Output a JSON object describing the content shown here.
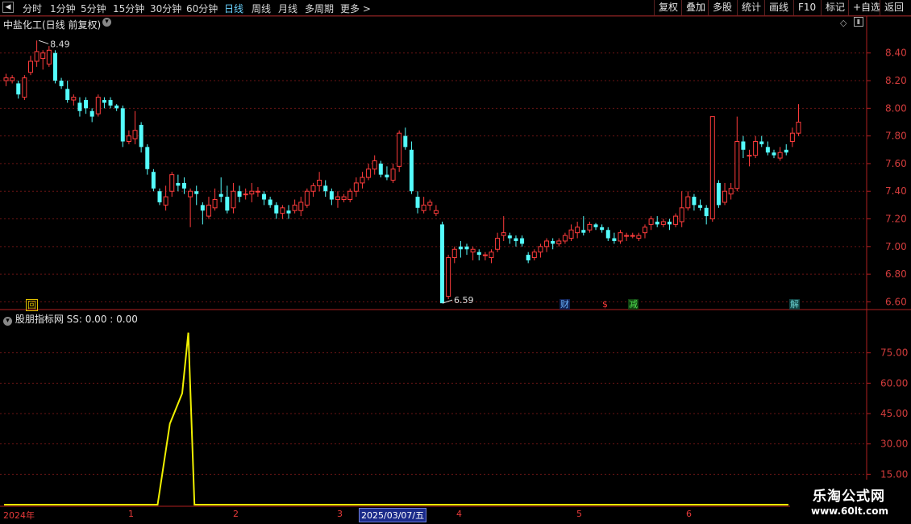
{
  "toolbar": {
    "periods": [
      "分时",
      "1分钟",
      "5分钟",
      "15分钟",
      "30分钟",
      "60分钟",
      "日线",
      "周线",
      "月线",
      "多周期",
      "更多 >"
    ],
    "buttons": [
      "复权",
      "叠加",
      "多股",
      "统计",
      "画线",
      "F10",
      "标记",
      "+自选",
      "返回"
    ]
  },
  "chart": {
    "title": "中盐化工(日线 前复权)",
    "price_axis": [
      "8.40",
      "8.20",
      "8.00",
      "7.80",
      "7.60",
      "7.40",
      "7.20",
      "7.00",
      "6.80",
      "6.60"
    ],
    "high_label": "8.49",
    "low_label": "6.59",
    "markers": [
      {
        "text": "回",
        "color": "#e0c000"
      },
      {
        "text": "财",
        "color": "#6ab4ff"
      },
      {
        "text": "$",
        "color": "#ff3a3a"
      },
      {
        "text": "减",
        "color": "#50e050"
      },
      {
        "text": "解",
        "color": "#6ad2d2"
      }
    ]
  },
  "indicator": {
    "title": "股朋指标网  SS: 0.00 : 0.00",
    "axis": [
      "75.00",
      "60.00",
      "45.00",
      "30.00",
      "15.00"
    ]
  },
  "timeline": {
    "labels": [
      "2024年",
      "1",
      "2",
      "3",
      "4",
      "5",
      "6"
    ],
    "selected_date": "2025/03/07/五"
  },
  "watermark": {
    "line1": "乐淘公式网",
    "line2": "www.60lt.com"
  },
  "chart_data": {
    "type": "candlestick",
    "ylim": [
      6.55,
      8.55
    ],
    "candles": [
      [
        8.2,
        8.22,
        8.25,
        8.16
      ],
      [
        8.2,
        8.22,
        8.24,
        8.18
      ],
      [
        8.18,
        8.1,
        8.2,
        8.07
      ],
      [
        8.08,
        8.22,
        8.24,
        8.06
      ],
      [
        8.26,
        8.34,
        8.38,
        8.24
      ],
      [
        8.34,
        8.41,
        8.49,
        8.3
      ],
      [
        8.36,
        8.4,
        8.42,
        8.28
      ],
      [
        8.32,
        8.42,
        8.45,
        8.3
      ],
      [
        8.4,
        8.2,
        8.42,
        8.18
      ],
      [
        8.2,
        8.16,
        8.22,
        8.14
      ],
      [
        8.14,
        8.06,
        8.2,
        8.04
      ],
      [
        8.06,
        8.08,
        8.1,
        8.02
      ],
      [
        8.04,
        7.98,
        8.08,
        7.94
      ],
      [
        8.06,
        8.0,
        8.08,
        7.96
      ],
      [
        7.98,
        7.94,
        8.0,
        7.9
      ],
      [
        7.96,
        8.08,
        8.1,
        7.94
      ],
      [
        8.06,
        8.04,
        8.08,
        8.0
      ],
      [
        8.06,
        8.02,
        8.08,
        8.0
      ],
      [
        8.02,
        8.0,
        8.03,
        7.98
      ],
      [
        8.0,
        7.76,
        8.02,
        7.72
      ],
      [
        7.76,
        7.8,
        7.84,
        7.74
      ],
      [
        7.78,
        7.84,
        7.98,
        7.74
      ],
      [
        7.88,
        7.72,
        7.9,
        7.68
      ],
      [
        7.72,
        7.56,
        7.74,
        7.52
      ],
      [
        7.54,
        7.42,
        7.56,
        7.4
      ],
      [
        7.4,
        7.32,
        7.42,
        7.3
      ],
      [
        7.3,
        7.36,
        7.44,
        7.26
      ],
      [
        7.4,
        7.52,
        7.54,
        7.36
      ],
      [
        7.46,
        7.44,
        7.52,
        7.4
      ],
      [
        7.46,
        7.42,
        7.5,
        7.38
      ],
      [
        7.36,
        7.4,
        7.42,
        7.14
      ],
      [
        7.4,
        7.38,
        7.44,
        7.3
      ],
      [
        7.3,
        7.26,
        7.32,
        7.16
      ],
      [
        7.22,
        7.3,
        7.36,
        7.2
      ],
      [
        7.28,
        7.34,
        7.42,
        7.26
      ],
      [
        7.38,
        7.36,
        7.5,
        7.32
      ],
      [
        7.36,
        7.26,
        7.44,
        7.24
      ],
      [
        7.28,
        7.4,
        7.46,
        7.24
      ],
      [
        7.4,
        7.36,
        7.44,
        7.32
      ],
      [
        7.38,
        7.38,
        7.42,
        7.34
      ],
      [
        7.38,
        7.4,
        7.46,
        7.32
      ],
      [
        7.4,
        7.4,
        7.43,
        7.36
      ],
      [
        7.38,
        7.34,
        7.4,
        7.3
      ],
      [
        7.34,
        7.3,
        7.36,
        7.28
      ],
      [
        7.3,
        7.24,
        7.32,
        7.2
      ],
      [
        7.24,
        7.28,
        7.3,
        7.2
      ],
      [
        7.26,
        7.24,
        7.3,
        7.2
      ],
      [
        7.26,
        7.3,
        7.34,
        7.24
      ],
      [
        7.26,
        7.32,
        7.36,
        7.22
      ],
      [
        7.3,
        7.4,
        7.42,
        7.28
      ],
      [
        7.4,
        7.44,
        7.46,
        7.36
      ],
      [
        7.44,
        7.48,
        7.54,
        7.4
      ],
      [
        7.44,
        7.4,
        7.48,
        7.36
      ],
      [
        7.4,
        7.34,
        7.42,
        7.3
      ],
      [
        7.34,
        7.36,
        7.4,
        7.28
      ],
      [
        7.34,
        7.36,
        7.38,
        7.32
      ],
      [
        7.34,
        7.4,
        7.42,
        7.32
      ],
      [
        7.4,
        7.46,
        7.5,
        7.36
      ],
      [
        7.46,
        7.5,
        7.54,
        7.42
      ],
      [
        7.5,
        7.56,
        7.6,
        7.48
      ],
      [
        7.56,
        7.62,
        7.66,
        7.52
      ],
      [
        7.6,
        7.52,
        7.62,
        7.5
      ],
      [
        7.52,
        7.5,
        7.58,
        7.48
      ],
      [
        7.48,
        7.56,
        7.6,
        7.46
      ],
      [
        7.58,
        7.82,
        7.84,
        7.54
      ],
      [
        7.8,
        7.72,
        7.86,
        7.7
      ],
      [
        7.7,
        7.4,
        7.76,
        7.38
      ],
      [
        7.36,
        7.28,
        7.4,
        7.24
      ],
      [
        7.26,
        7.3,
        7.36,
        7.24
      ],
      [
        7.3,
        7.32,
        7.34,
        7.26
      ],
      [
        7.24,
        7.26,
        7.3,
        7.22
      ],
      [
        7.16,
        6.59,
        7.18,
        6.59
      ],
      [
        6.64,
        6.92,
        6.94,
        6.62
      ],
      [
        6.92,
        6.98,
        7.0,
        6.88
      ],
      [
        7.0,
        6.98,
        7.04,
        6.92
      ],
      [
        7.0,
        6.98,
        7.02,
        6.94
      ],
      [
        6.96,
        6.98,
        7.0,
        6.9
      ],
      [
        6.96,
        6.94,
        6.98,
        6.9
      ],
      [
        6.94,
        6.94,
        6.96,
        6.9
      ],
      [
        6.92,
        6.96,
        6.98,
        6.88
      ],
      [
        6.98,
        7.06,
        7.1,
        6.96
      ],
      [
        7.08,
        7.1,
        7.22,
        7.04
      ],
      [
        7.08,
        7.06,
        7.1,
        7.02
      ],
      [
        7.06,
        7.04,
        7.08,
        7.0
      ],
      [
        7.06,
        7.02,
        7.08,
        7.0
      ],
      [
        6.94,
        6.9,
        6.96,
        6.88
      ],
      [
        6.92,
        6.96,
        6.98,
        6.9
      ],
      [
        6.96,
        7.0,
        7.02,
        6.92
      ],
      [
        7.0,
        7.04,
        7.06,
        6.96
      ],
      [
        7.04,
        7.02,
        7.06,
        6.98
      ],
      [
        7.02,
        7.04,
        7.06,
        7.0
      ],
      [
        7.04,
        7.08,
        7.1,
        7.02
      ],
      [
        7.06,
        7.12,
        7.16,
        7.04
      ],
      [
        7.1,
        7.14,
        7.18,
        7.06
      ],
      [
        7.12,
        7.1,
        7.22,
        7.08
      ],
      [
        7.12,
        7.16,
        7.18,
        7.1
      ],
      [
        7.16,
        7.14,
        7.17,
        7.12
      ],
      [
        7.14,
        7.12,
        7.16,
        7.1
      ],
      [
        7.12,
        7.06,
        7.14,
        7.04
      ],
      [
        7.06,
        7.04,
        7.1,
        7.02
      ],
      [
        7.04,
        7.1,
        7.12,
        7.02
      ],
      [
        7.08,
        7.08,
        7.1,
        7.04
      ],
      [
        7.08,
        7.08,
        7.1,
        7.06
      ],
      [
        7.06,
        7.08,
        7.1,
        7.04
      ],
      [
        7.1,
        7.14,
        7.16,
        7.06
      ],
      [
        7.16,
        7.2,
        7.22,
        7.12
      ],
      [
        7.18,
        7.16,
        7.22,
        7.14
      ],
      [
        7.16,
        7.18,
        7.2,
        7.14
      ],
      [
        7.18,
        7.16,
        7.2,
        7.12
      ],
      [
        7.16,
        7.22,
        7.24,
        7.14
      ],
      [
        7.18,
        7.28,
        7.4,
        7.14
      ],
      [
        7.28,
        7.36,
        7.4,
        7.26
      ],
      [
        7.36,
        7.3,
        7.38,
        7.26
      ],
      [
        7.3,
        7.28,
        7.34,
        7.26
      ],
      [
        7.28,
        7.22,
        7.3,
        7.16
      ],
      [
        7.2,
        7.94,
        7.94,
        7.18
      ],
      [
        7.46,
        7.3,
        7.48,
        7.28
      ],
      [
        7.32,
        7.4,
        7.46,
        7.3
      ],
      [
        7.38,
        7.42,
        7.46,
        7.34
      ],
      [
        7.42,
        7.76,
        7.94,
        7.4
      ],
      [
        7.76,
        7.7,
        7.8,
        7.64
      ],
      [
        7.66,
        7.66,
        7.7,
        7.58
      ],
      [
        7.66,
        7.76,
        7.8,
        7.64
      ],
      [
        7.76,
        7.74,
        7.8,
        7.72
      ],
      [
        7.72,
        7.68,
        7.76,
        7.66
      ],
      [
        7.68,
        7.66,
        7.7,
        7.64
      ],
      [
        7.64,
        7.68,
        7.72,
        7.62
      ],
      [
        7.7,
        7.68,
        7.74,
        7.66
      ],
      [
        7.76,
        7.82,
        7.86,
        7.72
      ],
      [
        7.82,
        7.9,
        8.03,
        7.8
      ]
    ],
    "indicator_series": {
      "name": "SS",
      "values_by_candle": [
        [
          0,
          0
        ],
        [
          25,
          0
        ],
        [
          27,
          40
        ],
        [
          29,
          55
        ],
        [
          30,
          85
        ],
        [
          31,
          0
        ],
        [
          140,
          0
        ]
      ]
    }
  }
}
